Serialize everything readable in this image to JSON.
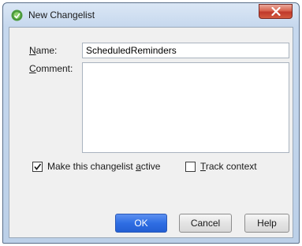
{
  "window": {
    "title": "New Changelist",
    "icon": "android-studio-icon",
    "close_icon": "close-icon"
  },
  "form": {
    "name_label_mnemonic": "N",
    "name_label_rest": "ame:",
    "name_value": "ScheduledReminders",
    "comment_label_mnemonic": "C",
    "comment_label_rest": "omment:",
    "comment_value": ""
  },
  "options": {
    "make_active_label_pre": "Make this changelist ",
    "make_active_label_mnemonic": "a",
    "make_active_label_post": "ctive",
    "make_active_checked": true,
    "track_context_mnemonic": "T",
    "track_context_rest": "rack context",
    "track_context_checked": false
  },
  "buttons": {
    "ok_label": "OK",
    "cancel_label": "Cancel",
    "help_label": "Help"
  },
  "colors": {
    "ok_button": "#2f6ee3",
    "close_button": "#c0392b",
    "title_bar": "#c6d8ee"
  }
}
